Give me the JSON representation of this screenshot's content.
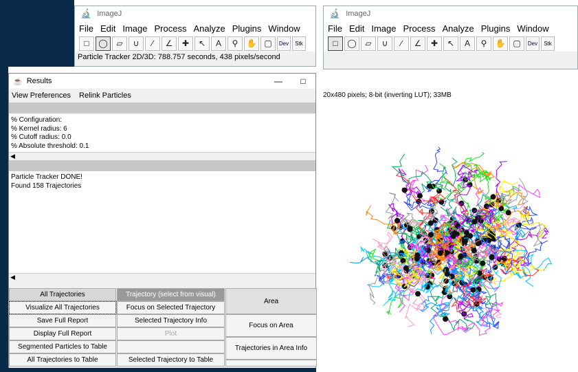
{
  "imagej_left": {
    "title": "ImageJ",
    "menu": [
      "File",
      "Edit",
      "Image",
      "Process",
      "Analyze",
      "Plugins",
      "Window"
    ],
    "status": "Particle Tracker 2D/3D: 788.757 seconds, 438 pixels/second",
    "tool_dev": "Dev",
    "tool_stk": "Stk"
  },
  "imagej_right": {
    "title": "ImageJ",
    "menu": [
      "File",
      "Edit",
      "Image",
      "Process",
      "Analyze",
      "Plugins",
      "Window"
    ],
    "tool_dev": "Dev",
    "tool_stk": "Stk"
  },
  "results": {
    "title": "Results",
    "menu": [
      "View Preferences",
      "Relink Particles"
    ],
    "config_lines": [
      "% Configuration:",
      "% Kernel radius: 6",
      "% Cutoff radius: 0.0",
      "% Absolute threshold: 0.1"
    ],
    "log_lines": [
      "Particle Tracker DONE!",
      "Found 158 Trajectories"
    ],
    "buttons": {
      "all_trajectories": "All Trajectories",
      "visualize_all": "Visualize All Trajectories",
      "save_full_report": "Save Full Report",
      "display_full_report": "Display Full Report",
      "segmented_to_table": "Segmented Particles to Table",
      "all_to_table": "All Trajectories to Table",
      "trajectory_select": "Trajectory (select from visual)",
      "focus_selected": "Focus on Selected Trajectory",
      "selected_info": "Selected Trajectory Info",
      "plot": "Plot",
      "selected_to_table": "Selected Trajectory to Table",
      "area": "Area",
      "focus_area": "Focus on Area",
      "traj_in_area": "Trajectories in Area Info"
    }
  },
  "image_window": {
    "status": "20x480 pixels; 8-bit (inverting LUT); 33MB"
  },
  "colors": {
    "desktop": "#0a2a4a",
    "imagej_logo": "#c8781e"
  }
}
